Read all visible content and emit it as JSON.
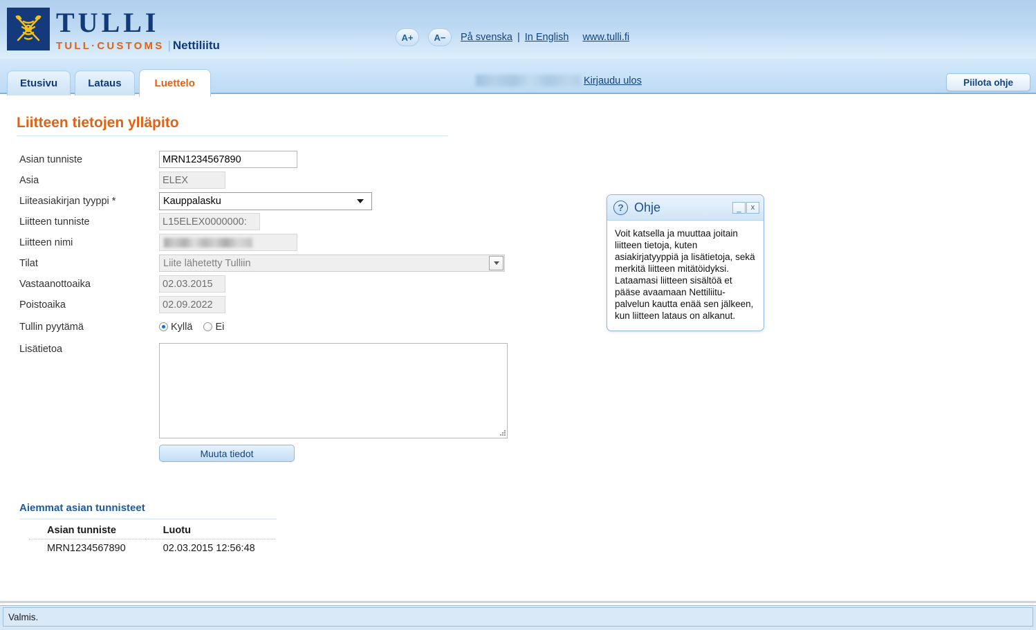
{
  "header": {
    "brand_main": "TULLI",
    "brand_sub": "TULL·CUSTOMS",
    "brand_divider": "|",
    "app_name": "Nettiliitu",
    "font_increase_label": "A+",
    "font_decrease_label": "A−",
    "lang_swedish": "På svenska",
    "lang_separator": "|",
    "lang_english": "In English",
    "site_link": "www.tulli.fi",
    "logo_icon": "customs-caduceus-icon"
  },
  "tabbar": {
    "tabs": [
      {
        "label": "Etusivu",
        "active": false
      },
      {
        "label": "Lataus",
        "active": false
      },
      {
        "label": "Luettelo",
        "active": true
      }
    ],
    "username_redacted": "",
    "logout_label": "Kirjaudu ulos",
    "hide_help_label": "Piilota ohje"
  },
  "main": {
    "page_title": "Liitteen tietojen ylläpito",
    "fields": [
      {
        "label": "Asian tunniste",
        "type": "text",
        "value": "MRN1234567890",
        "readonly": false,
        "name": "asian-tunniste-input"
      },
      {
        "label": "Asia",
        "type": "text",
        "value": "ELEX",
        "readonly": true,
        "name": "asia-input"
      },
      {
        "label": "Liiteasiakirjan tyyppi *",
        "type": "select",
        "value": "Kauppalasku",
        "readonly": false,
        "name": "liiteasiakirjan-tyyppi-select"
      },
      {
        "label": "Liitteen tunniste",
        "type": "text",
        "value": "L15ELEX0000000:",
        "readonly": true,
        "name": "liitteen-tunniste-input"
      },
      {
        "label": "Liitteen nimi",
        "type": "redacted",
        "value": "",
        "readonly": true,
        "name": "liitteen-nimi-input"
      },
      {
        "label": "Tilat",
        "type": "select-disabled",
        "value": "Liite lähetetty Tulliin",
        "readonly": true,
        "name": "tilat-select"
      },
      {
        "label": "Vastaanottoaika",
        "type": "text",
        "value": "02.03.2015",
        "readonly": true,
        "name": "vastaanottoaika-input"
      },
      {
        "label": "Poistoaika",
        "type": "text",
        "value": "02.09.2022",
        "readonly": true,
        "name": "poistoaika-input"
      }
    ],
    "radio_group": {
      "label": "Tullin pyytämä",
      "options": [
        {
          "label": "Kyllä",
          "checked": true
        },
        {
          "label": "Ei",
          "checked": false
        }
      ]
    },
    "textarea": {
      "label": "Lisätietoa",
      "value": "",
      "placeholder": ""
    },
    "submit_label": "Muuta tiedot"
  },
  "previous": {
    "section_title": "Aiemmat asian tunnisteet",
    "columns": [
      "Asian tunniste",
      "Luotu"
    ],
    "rows": [
      [
        "MRN1234567890",
        "02.03.2015 12:56:48"
      ]
    ]
  },
  "help": {
    "icon": "question-mark-icon",
    "title": "Ohje",
    "minimize_label": "_",
    "close_label": "x",
    "body": "Voit katsella ja muuttaa joitain liitteen tietoja, kuten asiakirjatyyppiä ja lisätietoja, sekä merkitä liitteen mitätöidyksi. Lataamasi liitteen sisältöä et pääse avaamaan Nettiliitu-palvelun kautta enää sen jälkeen, kun liitteen lataus on alkanut."
  },
  "statusbar": {
    "text": "Valmis."
  },
  "colors": {
    "brand_blue": "#123a78",
    "brand_orange": "#e4610f",
    "header_gradient_top": "#b0d0ee",
    "header_gradient_bottom": "#dceffb",
    "link_blue": "#12437f",
    "section_heading_blue": "#1b5a9e",
    "status_bg": "#dae9f8"
  }
}
